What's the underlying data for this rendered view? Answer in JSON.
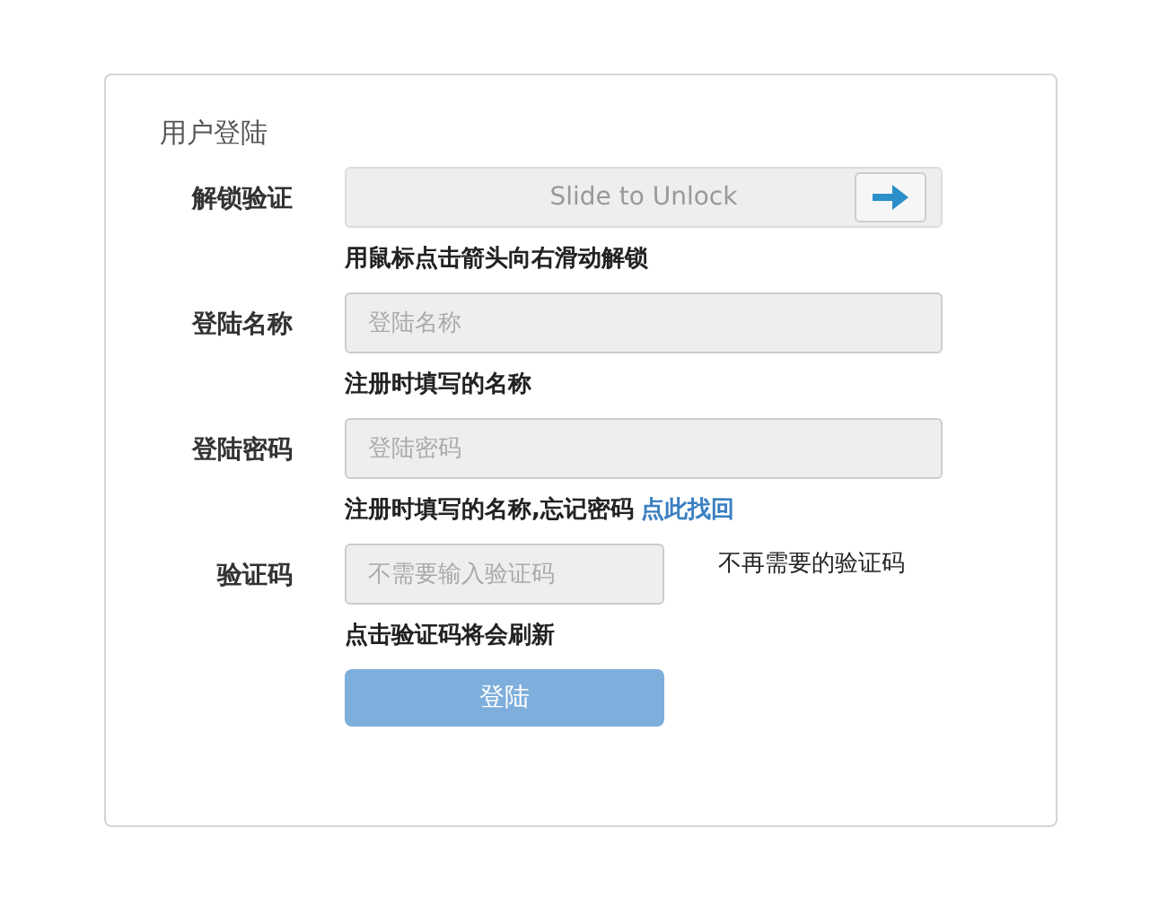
{
  "card": {
    "title": "用户登陆"
  },
  "rows": [
    {
      "kind": "slider",
      "label": "解锁验证",
      "text": "Slide to Unlock",
      "hint": "用鼠标点击箭头向右滑动解锁"
    },
    {
      "kind": "input",
      "label": "登陆名称",
      "placeholder": "登陆名称",
      "hint": "注册时填写的名称"
    },
    {
      "kind": "input",
      "label": "登陆密码",
      "placeholder": "登陆密码",
      "hint": "注册时填写的名称,忘记密码",
      "link": "点此找回"
    },
    {
      "kind": "captcha",
      "label": "验证码",
      "placeholder": "不需要输入验证码",
      "side": "不再需要的验证码",
      "hint": "点击验证码将会刷新"
    }
  ],
  "submit": {
    "label": "登陆"
  }
}
